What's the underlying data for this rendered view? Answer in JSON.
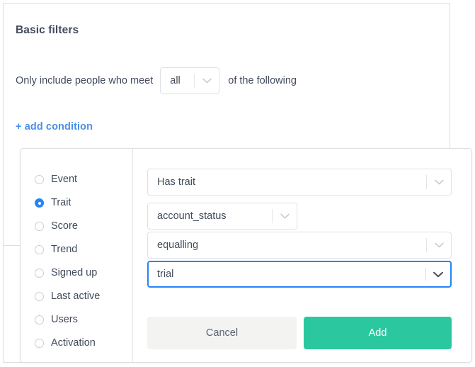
{
  "section": {
    "title": "Basic filters",
    "sentence_prefix": "Only include people who meet",
    "match_select_value": "all",
    "sentence_suffix": "of the following",
    "add_condition_label": "+ add condition"
  },
  "condition_panel": {
    "types": [
      {
        "label": "Event",
        "selected": false
      },
      {
        "label": "Trait",
        "selected": true
      },
      {
        "label": "Score",
        "selected": false
      },
      {
        "label": "Trend",
        "selected": false
      },
      {
        "label": "Signed up",
        "selected": false
      },
      {
        "label": "Last active",
        "selected": false
      },
      {
        "label": "Users",
        "selected": false
      },
      {
        "label": "Activation",
        "selected": false
      }
    ],
    "fields": {
      "predicate_value": "Has trait",
      "trait_value": "account_status",
      "operator_value": "equalling",
      "comparison_value": "trial"
    },
    "buttons": {
      "cancel_label": "Cancel",
      "add_label": "Add"
    }
  },
  "colors": {
    "accent_blue": "#2684f7",
    "link_blue": "#4a90e8",
    "add_green": "#2bc8a0",
    "cancel_gray": "#f3f3f2",
    "text": "#414b5c",
    "border": "#dcdee2"
  }
}
